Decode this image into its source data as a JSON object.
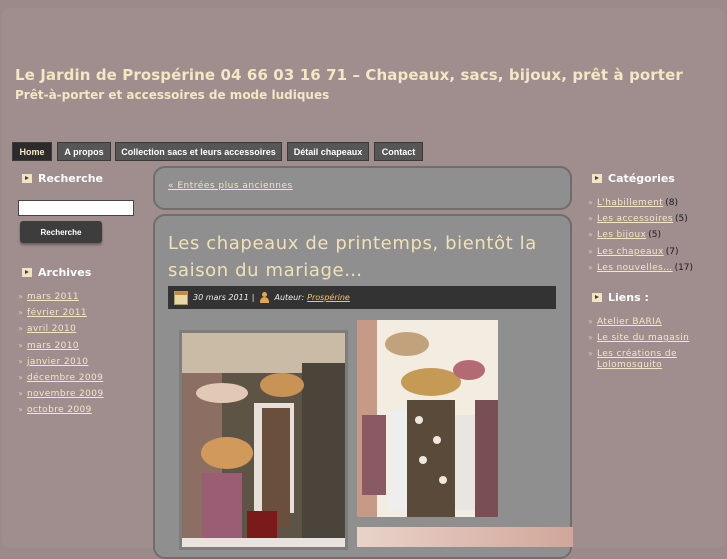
{
  "header": {
    "title": "Le Jardin de Prospérine 04 66 03 16 71 – Chapeaux, sacs, bijoux, prêt à porter",
    "description": "Prêt-à-porter et accessoires de mode ludiques"
  },
  "nav": {
    "items": [
      {
        "label": "Home",
        "active": true
      },
      {
        "label": "A propos"
      },
      {
        "label": "Collection sacs et leurs accessoires"
      },
      {
        "label": "Détail chapeaux"
      },
      {
        "label": "Contact"
      }
    ]
  },
  "left_sidebar": {
    "search": {
      "heading": "Recherche",
      "button": "Recherche",
      "value": ""
    },
    "archives": {
      "heading": "Archives",
      "items": [
        "mars 2011",
        "février 2011",
        "avril 2010",
        "mars 2010",
        "janvier 2010",
        "décembre 2009",
        "novembre 2009",
        "octobre 2009"
      ]
    }
  },
  "content": {
    "older_link": "« Entrées plus anciennes",
    "post": {
      "title": "Les chapeaux de printemps, bientôt la saison du mariage…",
      "date": "30 mars 2011",
      "separator": "|",
      "author_label": "Auteur:",
      "author": "Prospérine"
    }
  },
  "right_sidebar": {
    "categories": {
      "heading": "Catégories",
      "items": [
        {
          "label": "L'habillement",
          "count": "(8)"
        },
        {
          "label": "Les accessoires",
          "count": "(5)"
        },
        {
          "label": "Les bijoux",
          "count": "(5)"
        },
        {
          "label": "Les chapeaux",
          "count": "(7)"
        },
        {
          "label": "Les nouvelles…",
          "count": "(17)"
        }
      ]
    },
    "links": {
      "heading": "Liens :",
      "items": [
        "Atelier BARIA",
        "Le site du magasin",
        "Les créations de Lolomosquito"
      ]
    }
  },
  "colors": {
    "background": "#a08d8e",
    "title": "#f3e7c4",
    "post_title": "#f1e1b7",
    "link": "#f3e7c4",
    "nav_active": "#2b2b2b",
    "nav": "#565656"
  }
}
